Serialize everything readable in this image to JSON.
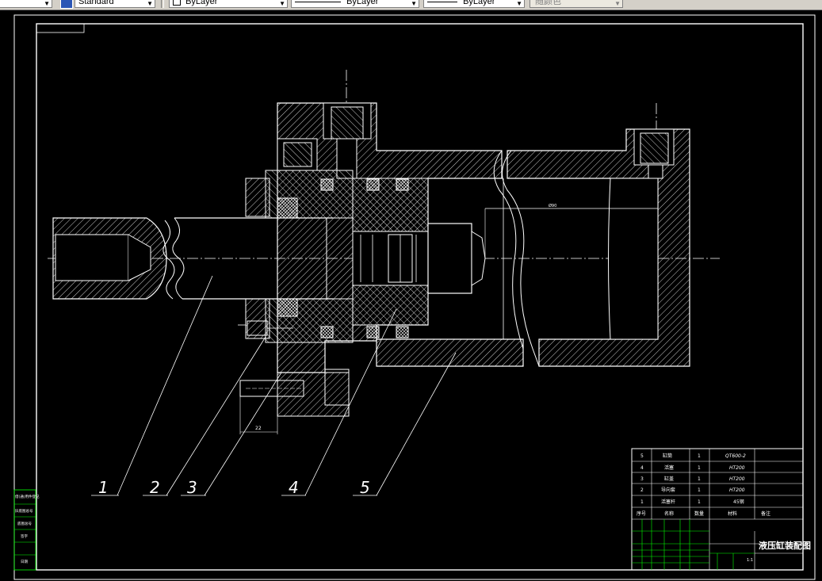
{
  "toolbar": {
    "text_style": "Standard",
    "layer": "ByLayer",
    "linetype": "ByLayer",
    "lineweight": "ByLayer",
    "plotstyle": "随颜色"
  },
  "drawing": {
    "leader_labels": [
      "1",
      "2",
      "3",
      "4",
      "5"
    ],
    "dim_small": "22",
    "dim_bore": "Ø90",
    "title_block": {
      "drawing_title": "液压缸装配图",
      "bom": [
        {
          "no": "5",
          "name": "缸筒",
          "qty": "1",
          "material": "QT600-2"
        },
        {
          "no": "4",
          "name": "活塞",
          "qty": "1",
          "material": "HT200"
        },
        {
          "no": "3",
          "name": "缸盖",
          "qty": "1",
          "material": "HT200"
        },
        {
          "no": "2",
          "name": "导向套",
          "qty": "1",
          "material": "HT200"
        },
        {
          "no": "1",
          "name": "活塞杆",
          "qty": "1",
          "material": "45钢"
        }
      ],
      "bom_header": {
        "no": "序号",
        "name": "名称",
        "qty": "数量",
        "material": "材料",
        "remark": "备注"
      },
      "scale": "1:1"
    },
    "side_table": [
      "借(通)用件登记",
      "旧底图总号",
      "底图总号",
      "签字",
      "日期"
    ]
  },
  "colors": {
    "background": "#000000",
    "outline": "#ffffff",
    "hatch": "#ffffff",
    "table": "#00ff00",
    "toolbar": "#d4d0c8"
  }
}
